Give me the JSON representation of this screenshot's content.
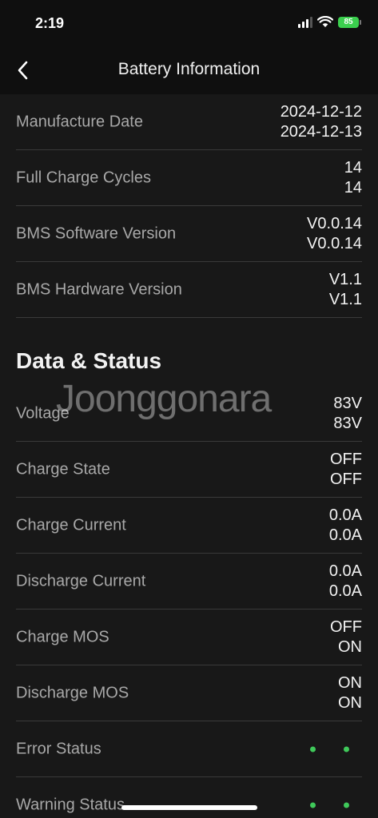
{
  "status_bar": {
    "time": "2:19",
    "battery_level": "85"
  },
  "header": {
    "title": "Battery Information"
  },
  "battery_rows": [
    {
      "label": "Manufacture Date",
      "values": [
        "2024-12-12",
        "2024-12-13"
      ]
    },
    {
      "label": "Full Charge Cycles",
      "values": [
        "14",
        "14"
      ]
    },
    {
      "label": "BMS Software Version",
      "values": [
        "V0.0.14",
        "V0.0.14"
      ]
    },
    {
      "label": "BMS Hardware Version",
      "values": [
        "V1.1",
        "V1.1"
      ]
    }
  ],
  "data_status": {
    "title": "Data & Status",
    "rows": [
      {
        "label": "Voltage",
        "values": [
          "83V",
          "83V"
        ]
      },
      {
        "label": "Charge State",
        "values": [
          "OFF",
          "OFF"
        ]
      },
      {
        "label": "Charge Current",
        "values": [
          "0.0A",
          "0.0A"
        ]
      },
      {
        "label": "Discharge Current",
        "values": [
          "0.0A",
          "0.0A"
        ]
      },
      {
        "label": "Charge MOS",
        "values": [
          "OFF",
          "ON"
        ]
      },
      {
        "label": "Discharge MOS",
        "values": [
          "ON",
          "ON"
        ]
      }
    ],
    "error_status_label": "Error Status",
    "warning_status_label": "Warning Status",
    "status_dot_color": "#3fc95a"
  },
  "watermark": "Joonggonara",
  "icons": {
    "back": "chevron-left-icon",
    "signal": "cellular-signal-icon",
    "wifi": "wifi-icon",
    "battery": "battery-icon"
  }
}
